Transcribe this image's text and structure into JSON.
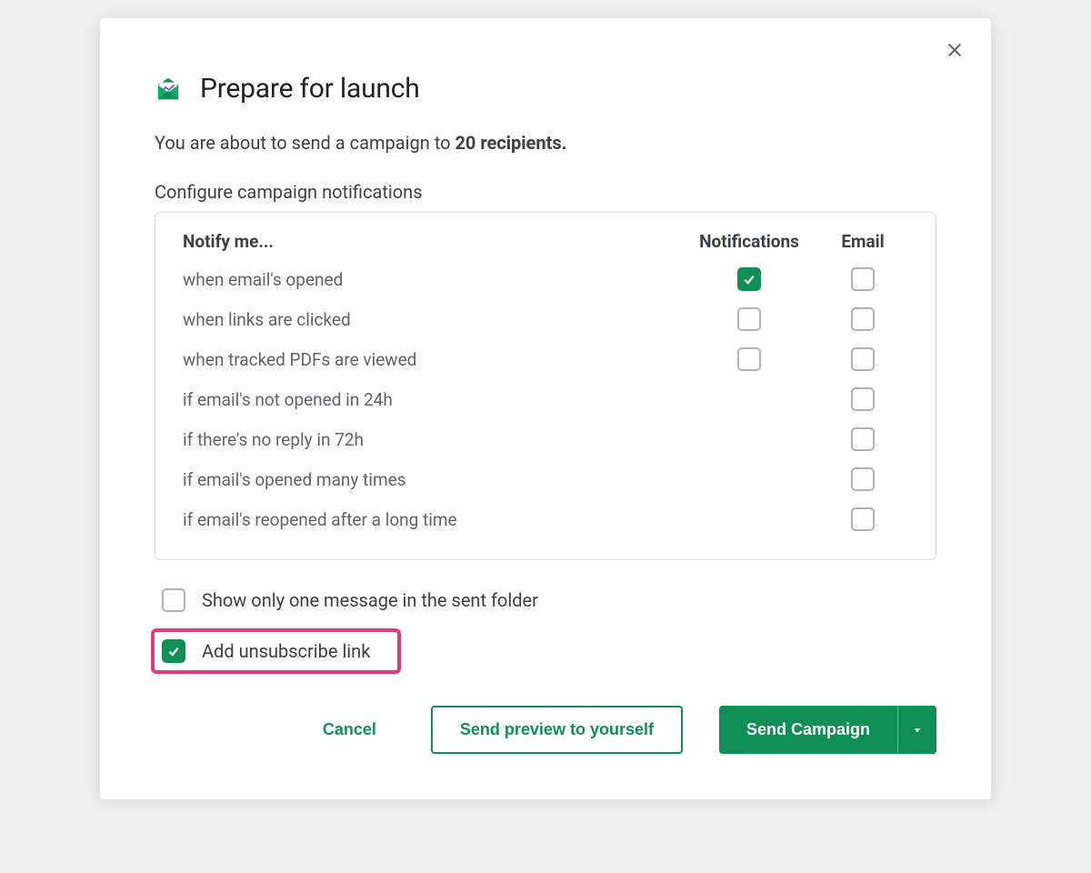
{
  "dialog": {
    "title": "Prepare for launch",
    "intro_prefix": "You are about to send a campaign to ",
    "intro_bold": "20 recipients.",
    "section_label": "Configure campaign notifications"
  },
  "table": {
    "header_notify": "Notify me...",
    "header_notifications": "Notifications",
    "header_email": "Email",
    "rows": [
      {
        "label": "when email's opened",
        "notif": true,
        "email": false,
        "has_notif": true
      },
      {
        "label": "when links are clicked",
        "notif": false,
        "email": false,
        "has_notif": true
      },
      {
        "label": "when tracked PDFs are viewed",
        "notif": false,
        "email": false,
        "has_notif": true
      },
      {
        "label": "if email's not opened in 24h",
        "notif": null,
        "email": false,
        "has_notif": false
      },
      {
        "label": "if there's no reply in 72h",
        "notif": null,
        "email": false,
        "has_notif": false
      },
      {
        "label": "if email's opened many times",
        "notif": null,
        "email": false,
        "has_notif": false
      },
      {
        "label": "if email's reopened after a long time",
        "notif": null,
        "email": false,
        "has_notif": false
      }
    ]
  },
  "options": {
    "show_one_message": {
      "label": "Show only one message in the sent folder",
      "checked": false
    },
    "add_unsubscribe": {
      "label": "Add unsubscribe link",
      "checked": true
    }
  },
  "actions": {
    "cancel": "Cancel",
    "send_preview": "Send preview to yourself",
    "send_campaign": "Send Campaign"
  },
  "colors": {
    "primary": "#0f8e55",
    "highlight": "#e5397e"
  }
}
